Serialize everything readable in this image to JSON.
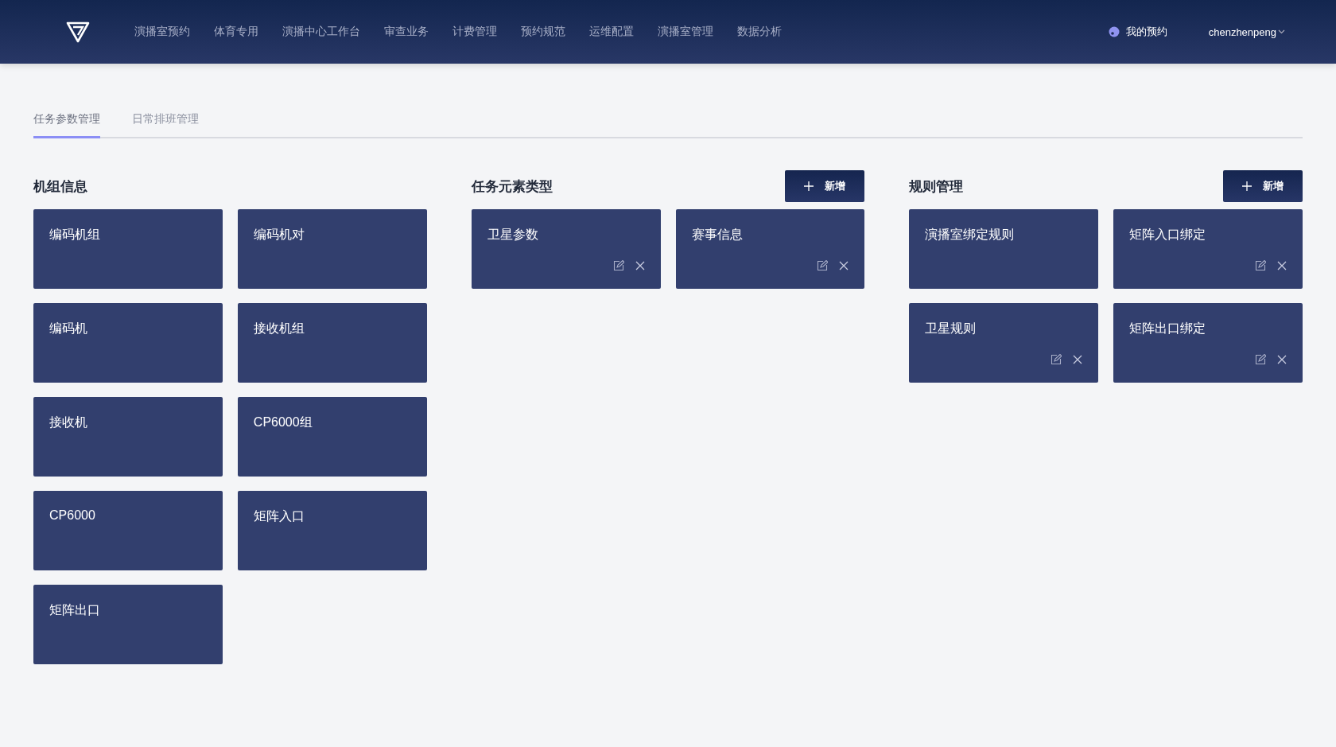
{
  "nav": {
    "items": [
      {
        "label": "演播室预约",
        "selected": false
      },
      {
        "label": "体育专用",
        "selected": false
      },
      {
        "label": "演播中心工作台",
        "selected": false
      },
      {
        "label": "审查业务",
        "selected": false
      },
      {
        "label": "计费管理",
        "selected": false
      },
      {
        "label": "预约规范",
        "selected": false
      },
      {
        "label": "运维配置",
        "selected": false
      },
      {
        "label": "演播室管理",
        "selected": false
      },
      {
        "label": "数据分析",
        "selected": false
      }
    ],
    "my_booking": "我的预约",
    "user": "chenzhenpeng"
  },
  "tabs": [
    {
      "label": "任务参数管理",
      "selected": true
    },
    {
      "label": "日常排班管理",
      "selected": false
    }
  ],
  "sections": [
    {
      "title": "机组信息",
      "cards": [
        {
          "label": "编码机组",
          "editable": false
        },
        {
          "label": "编码机对",
          "editable": false
        },
        {
          "label": "编码机",
          "editable": false
        },
        {
          "label": "接收机组",
          "editable": false
        },
        {
          "label": "接收机",
          "editable": false
        },
        {
          "label": "CP6000组",
          "editable": false
        },
        {
          "label": "CP6000",
          "editable": false
        },
        {
          "label": "矩阵入口",
          "editable": false
        },
        {
          "label": "矩阵出口",
          "editable": false
        }
      ]
    },
    {
      "title": "任务元素类型",
      "add_button": "新增",
      "cards": [
        {
          "label": "卫星参数",
          "editable": true
        },
        {
          "label": "赛事信息",
          "editable": true
        }
      ]
    },
    {
      "title": "规则管理",
      "add_button": "新增",
      "cards": [
        {
          "label": "演播室绑定规则",
          "editable": false
        },
        {
          "label": "矩阵入口绑定",
          "editable": true
        },
        {
          "label": "卫星规则",
          "editable": true
        },
        {
          "label": "矩阵出口绑定",
          "editable": true
        }
      ]
    }
  ]
}
